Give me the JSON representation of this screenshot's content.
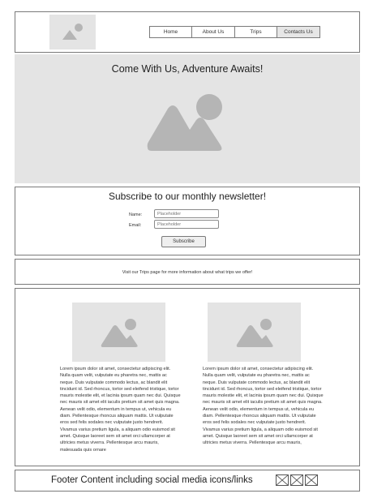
{
  "nav": {
    "items": [
      {
        "label": "Home"
      },
      {
        "label": "About Us"
      },
      {
        "label": "Trips"
      },
      {
        "label": "Contacts Us"
      }
    ]
  },
  "hero": {
    "title": "Come With Us, Adventure Awaits!"
  },
  "newsletter": {
    "title": "Subscribe to our monthly newsletter!",
    "name_label": "Name:",
    "email_label": "Email:",
    "name_placeholder": "Placeholder",
    "email_placeholder": "Placeholder",
    "subscribe_label": "Subscribe"
  },
  "info": {
    "text": "Visit our Trips page for more information about what trips we offer!"
  },
  "cards": [
    {
      "text": "Lorem ipsum dolor sit amet, consectetur adipiscing elit. Nulla quam velit, vulputate eu pharetra nec, mattis ac neque. Duis vulputate commodo lectus, ac blandit elit tincidunt id. Sed rhoncus, tortor sed eleifend tristique, tortor mauris molestie elit, et lacinia ipsum quam nec dui. Quisque nec mauris sit amet elit iaculis pretium sit amet quis magna. Aenean velit odio, elementum in tempus ut, vehicula eu diam. Pellentesque rhoncus aliquam mattis. Ut vulputate eros sed felis sodales nec vulputate justo hendrerit. Vivamus varius pretium ligula, a aliquam odio euismod sit amet. Quisque laoreet sem sit amet orci ullamcorper at ultricies metus viverra. Pellentesque arcu mauris, malesuada quis ornare"
    },
    {
      "text": "Lorem ipsum dolor sit amet, consectetur adipiscing elit. Nulla quam velit, vulputate eu pharetra nec, mattis ac neque. Duis vulputate commodo lectus, ac blandit elit tincidunt id. Sed rhoncus, tortor sed eleifend tristique, tortor mauris molestie elit, et lacinia ipsum quam nec dui. Quisque nec mauris sit amet elit iaculis pretium sit amet quis magna. Aenean velit odio, elementum in tempus ut, vehicula eu diam. Pellentesque rhoncus aliquam mattis. Ut vulputate eros sed felis sodales nec vulputate justo hendrerit. Vivamus varius pretium ligula, a aliquam odio euismod sit amet. Quisque laoreet sem sit amet orci ullamcorper at ultricies metus viverra. Pellentesque arcu mauris,"
    }
  ],
  "footer": {
    "text": "Footer Content including social media icons/links"
  },
  "icons": {
    "image_placeholder": "image-icon",
    "social": "social-placeholder-icon"
  },
  "colors": {
    "placeholder_fill": "#e4e4e4",
    "placeholder_glyph": "#b5b5b5",
    "border": "#7a7a7a"
  }
}
